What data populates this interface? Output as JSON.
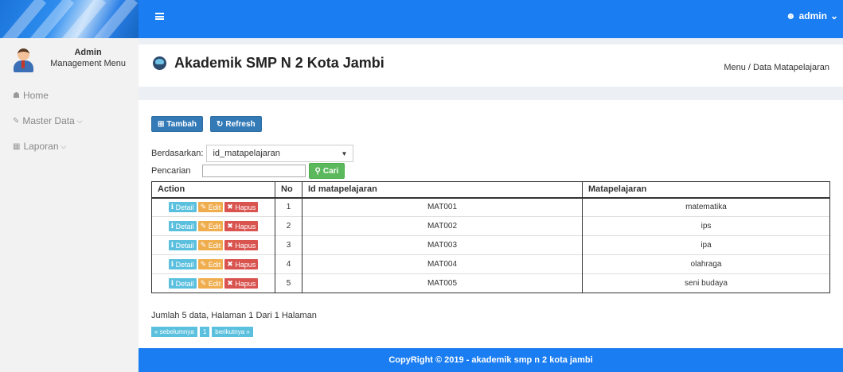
{
  "sidebar": {
    "user_name": "Admin",
    "user_role": "Management Menu",
    "items": [
      {
        "icon": "home-icon",
        "label": "Home",
        "chevron": ""
      },
      {
        "icon": "edit-icon",
        "label": "Master Data",
        "chevron": "⌵"
      },
      {
        "icon": "calendar-icon",
        "label": "Laporan",
        "chevron": "⌵"
      }
    ]
  },
  "topbar": {
    "user_label": "admin"
  },
  "header": {
    "title": "Akademik SMP N 2 Kota Jambi",
    "breadcrumb": "Menu / Data Matapelajaran"
  },
  "toolbar": {
    "tambah_label": "Tambah",
    "refresh_label": "Refresh"
  },
  "filter": {
    "label": "Berdasarkan:",
    "selected": "id_matapelajaran",
    "search_label": "Pencarian",
    "search_value": "",
    "search_button": "Cari"
  },
  "table": {
    "headers": [
      "Action",
      "No",
      "Id matapelajaran",
      "Matapelajaran"
    ],
    "action_labels": {
      "detail": "Detail",
      "edit": "Edit",
      "hapus": "Hapus"
    },
    "rows": [
      {
        "no": "1",
        "id": "MAT001",
        "name": "matematika"
      },
      {
        "no": "2",
        "id": "MAT002",
        "name": "ips"
      },
      {
        "no": "3",
        "id": "MAT003",
        "name": "ipa"
      },
      {
        "no": "4",
        "id": "MAT004",
        "name": "olahraga"
      },
      {
        "no": "5",
        "id": "MAT005",
        "name": "seni budaya"
      }
    ]
  },
  "summary": "Jumlah 5 data, Halaman 1 Dari 1 Halaman",
  "pager": {
    "prev": "« sebelumnya",
    "current": "1",
    "next": "berikutnya »"
  },
  "footer": "CopyRight © 2019 - akademik smp n 2 kota jambi",
  "colors": {
    "primary": "#1a7df2",
    "btn_blue": "#337ab7",
    "btn_green": "#5cb85c",
    "detail": "#5bc0de",
    "edit": "#f0ad4e",
    "hapus": "#d9534f"
  }
}
